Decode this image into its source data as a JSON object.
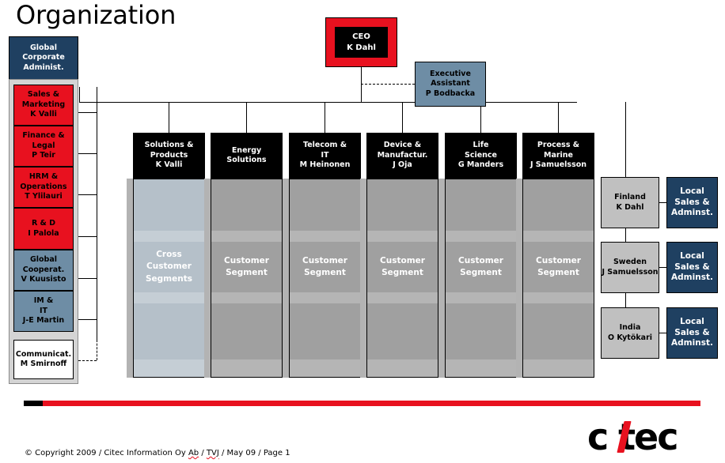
{
  "page_title": "Organization",
  "ceo": {
    "title": "CEO",
    "name": "K Dahl"
  },
  "executive_assistant": {
    "line1": "Executive",
    "line2": "Assistant",
    "line3": "P Bodbacka"
  },
  "sidebar": {
    "header": {
      "line1": "Global",
      "line2": "Corporate",
      "line3": "Administ."
    },
    "items": [
      {
        "line1": "Sales &",
        "line2": "Marketing",
        "line3": "K Valli",
        "color": "#e8111f",
        "text_color": "#000000"
      },
      {
        "line1": "Finance &",
        "line2": "Legal",
        "line3": "P Teir",
        "color": "#e8111f",
        "text_color": "#000000"
      },
      {
        "line1": "HRM &",
        "line2": "Operations",
        "line3": "T Ylilauri",
        "color": "#e8111f",
        "text_color": "#000000"
      },
      {
        "line1": "R & D",
        "line2": "I Palola",
        "line3": "",
        "color": "#e8111f",
        "text_color": "#000000"
      },
      {
        "line1": "Global",
        "line2": "Cooperat.",
        "line3": "V Kuusisto",
        "color": "#6e8da5",
        "text_color": "#000000"
      },
      {
        "line1": "IM &",
        "line2": "IT",
        "line3": "J-E Martin",
        "color": "#6e8da5",
        "text_color": "#000000"
      },
      {
        "line1": "Communicat.",
        "line2": "M Smirnoff",
        "line3": "",
        "color": "#ffffff",
        "text_color": "#000000"
      }
    ]
  },
  "divisions": [
    {
      "line1": "Solutions &",
      "line2": "Products",
      "line3": "K Valli",
      "segment": "Cross\nCustomer\nSegments",
      "segment_l1": "Cross",
      "segment_l2": "Customer",
      "segment_l3": "Segments",
      "highlight": true
    },
    {
      "line1": "Energy",
      "line2": "Solutions",
      "line3": "",
      "segment_l1": "Customer",
      "segment_l2": "Segment",
      "segment_l3": "",
      "highlight": false
    },
    {
      "line1": "Telecom &",
      "line2": "IT",
      "line3": "M Heinonen",
      "segment_l1": "Customer",
      "segment_l2": "Segment",
      "segment_l3": "",
      "highlight": false
    },
    {
      "line1": "Device &",
      "line2": "Manufactur.",
      "line3": "J Oja",
      "segment_l1": "Customer",
      "segment_l2": "Segment",
      "segment_l3": "",
      "highlight": false
    },
    {
      "line1": "Life",
      "line2": "Science",
      "line3": "G Manders",
      "segment_l1": "Customer",
      "segment_l2": "Segment",
      "segment_l3": "",
      "highlight": false
    },
    {
      "line1": "Process &",
      "line2": "Marine",
      "line3": "J Samuelsson",
      "segment_l1": "Customer",
      "segment_l2": "Segment",
      "segment_l3": "",
      "highlight": false
    }
  ],
  "countries": [
    {
      "name": "Finland",
      "manager": "K Dahl",
      "local": {
        "line1": "Local",
        "line2": "Sales &",
        "line3": "Adminst."
      }
    },
    {
      "name": "Sweden",
      "manager": "J Samuelsson",
      "local": {
        "line1": "Local",
        "line2": "Sales &",
        "line3": "Adminst."
      }
    },
    {
      "name": "India",
      "manager": "O Kytökari",
      "local": {
        "line1": "Local",
        "line2": "Sales &",
        "line3": "Adminst."
      }
    }
  ],
  "footer": {
    "part1": "© Copyright 2009 / Citec Information Oy ",
    "part2": "Ab",
    "part3": " / ",
    "part4": "TVJ",
    "part5": " / May 09 / Page 1"
  },
  "logo": {
    "text_before": "c",
    "text_after": "tec",
    "accent_color": "#e8111f"
  },
  "colors": {
    "red": "#e8111f",
    "navy": "#1f4061",
    "steel": "#6e8da5",
    "grey": "#a0a0a0",
    "light_grey": "#b5c0c9",
    "country_grey": "#c0c0c0"
  }
}
